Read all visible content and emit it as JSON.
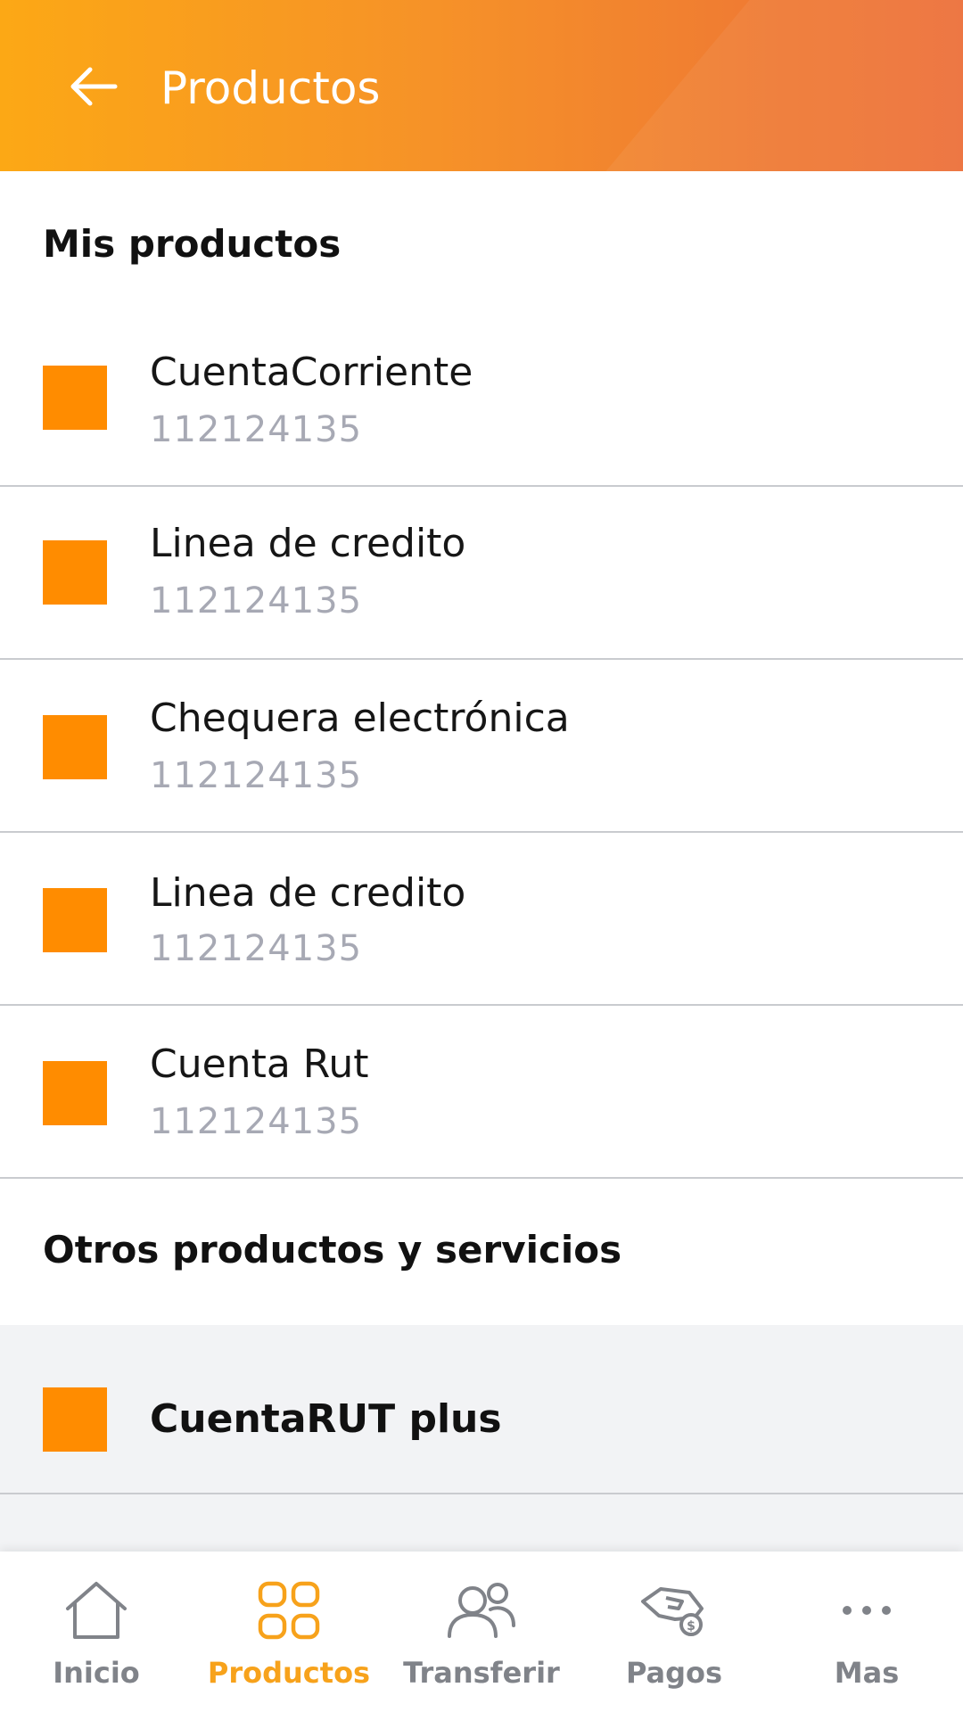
{
  "header": {
    "title": "Productos",
    "back_icon": "arrow-left-icon"
  },
  "my_products": {
    "title": "Mis productos",
    "items": [
      {
        "name": "CuentaCorriente",
        "number": "112124135"
      },
      {
        "name": "Linea de credito",
        "number": "112124135"
      },
      {
        "name": "Chequera electrónica",
        "number": "112124135"
      },
      {
        "name": "Linea de credito",
        "number": "112124135"
      },
      {
        "name": "Cuenta Rut",
        "number": "112124135"
      }
    ]
  },
  "other_products": {
    "title": "Otros productos y servicios",
    "items": [
      {
        "name": "CuentaRUT plus"
      }
    ]
  },
  "nav": {
    "items": [
      {
        "label": "Inicio",
        "icon": "home-icon"
      },
      {
        "label": "Productos",
        "icon": "grid-icon",
        "active": true
      },
      {
        "label": "Transferir",
        "icon": "users-icon"
      },
      {
        "label": "Pagos",
        "icon": "payment-hand-icon"
      },
      {
        "label": "Mas",
        "icon": "more-dots-icon"
      }
    ]
  },
  "colors": {
    "accent": "#ff8c00",
    "header_start": "#fca815",
    "header_end": "#ec6f39",
    "nav_active": "#f7a21b",
    "nav_inactive": "#808389",
    "account_number": "#a7a9b4"
  }
}
